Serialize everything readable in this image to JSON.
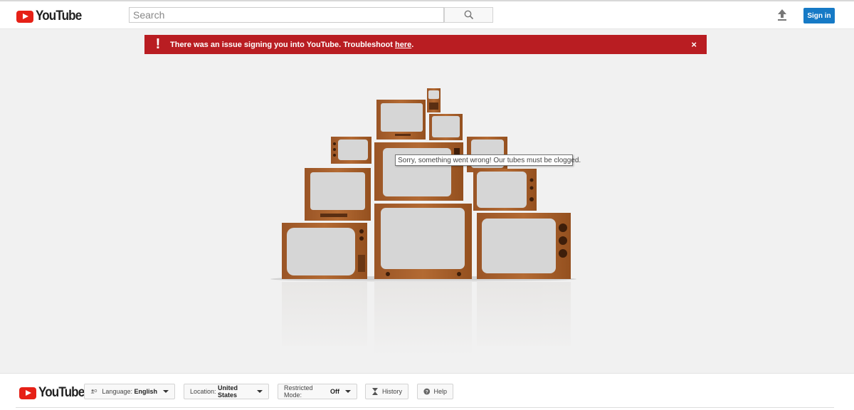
{
  "brand": {
    "name": "YouTube",
    "color": "#e62117"
  },
  "header": {
    "search": {
      "placeholder": "Search",
      "value": ""
    },
    "search_icon": "magnifier-icon",
    "upload_icon": "upload-arrow-icon",
    "signin_label": "Sign in",
    "accent": "#167ac6"
  },
  "alert": {
    "icon": "exclamation-icon",
    "message": "There was an issue signing you into YouTube. Troubleshoot ",
    "link_text": "here",
    "suffix": ".",
    "close": "×",
    "color": "#b91d22"
  },
  "error": {
    "tooltip": "Sorry, something went wrong! Our tubes must be clogged."
  },
  "footer": {
    "language_label": "Language:",
    "language_value": "English",
    "location_label": "Location:",
    "location_value": "United States",
    "restricted_label": "Restricted Mode:",
    "restricted_value": "Off",
    "history_label": "History",
    "help_label": "Help"
  }
}
